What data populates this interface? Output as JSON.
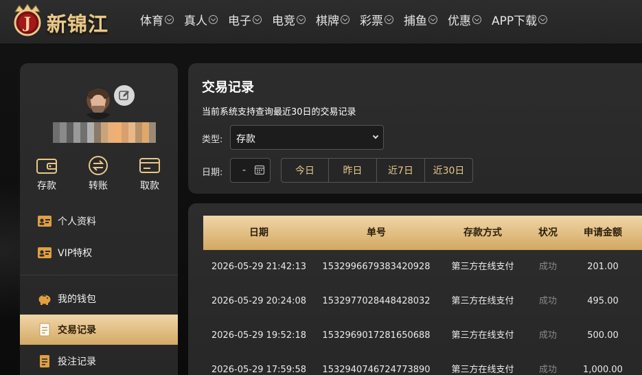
{
  "brand": {
    "name": "新锦江",
    "emblem_letter": "J"
  },
  "nav": [
    {
      "label": "体育"
    },
    {
      "label": "真人"
    },
    {
      "label": "电子"
    },
    {
      "label": "电竞"
    },
    {
      "label": "棋牌"
    },
    {
      "label": "彩票"
    },
    {
      "label": "捕鱼"
    },
    {
      "label": "优惠"
    },
    {
      "label": "APP下载"
    }
  ],
  "sidebar": {
    "quick_actions": [
      {
        "label": "存款",
        "icon": "wallet-icon"
      },
      {
        "label": "转账",
        "icon": "transfer-icon"
      },
      {
        "label": "取款",
        "icon": "card-icon"
      }
    ],
    "menu": [
      {
        "label": "个人资料",
        "icon": "id-card-icon"
      },
      {
        "label": "VIP特权",
        "icon": "vip-card-icon"
      },
      {
        "label": "我的钱包",
        "icon": "piggy-bank-icon"
      },
      {
        "label": "交易记录",
        "icon": "document-icon",
        "active": true
      },
      {
        "label": "投注记录",
        "icon": "bet-record-icon"
      }
    ]
  },
  "filter": {
    "title": "交易记录",
    "note": "当前系统支持查询最近30日的交易记录",
    "type_label": "类型:",
    "type_value": "存款",
    "date_label": "日期:",
    "date_value": "-",
    "ranges": [
      "今日",
      "昨日",
      "近7日",
      "近30日"
    ]
  },
  "table": {
    "headers": [
      "日期",
      "单号",
      "存款方式",
      "状况",
      "申请金额"
    ],
    "rows": [
      [
        "2026-05-29 21:42:13",
        "1532996679383420928",
        "第三方在线支付",
        "成功",
        "201.00"
      ],
      [
        "2026-05-29 20:24:08",
        "1532977028448428032",
        "第三方在线支付",
        "成功",
        "495.00"
      ],
      [
        "2026-05-29 19:52:18",
        "1532969017281650688",
        "第三方在线支付",
        "成功",
        "500.00"
      ],
      [
        "2026-05-29 17:59:58",
        "1532940746724773890",
        "第三方在线支付",
        "成功",
        "1,000.00"
      ]
    ]
  },
  "colors": {
    "gold": "#e8c98c",
    "gold_light": "#f1d6a8",
    "gold_dark": "#d2a862",
    "panel": "#2b2b2b"
  }
}
